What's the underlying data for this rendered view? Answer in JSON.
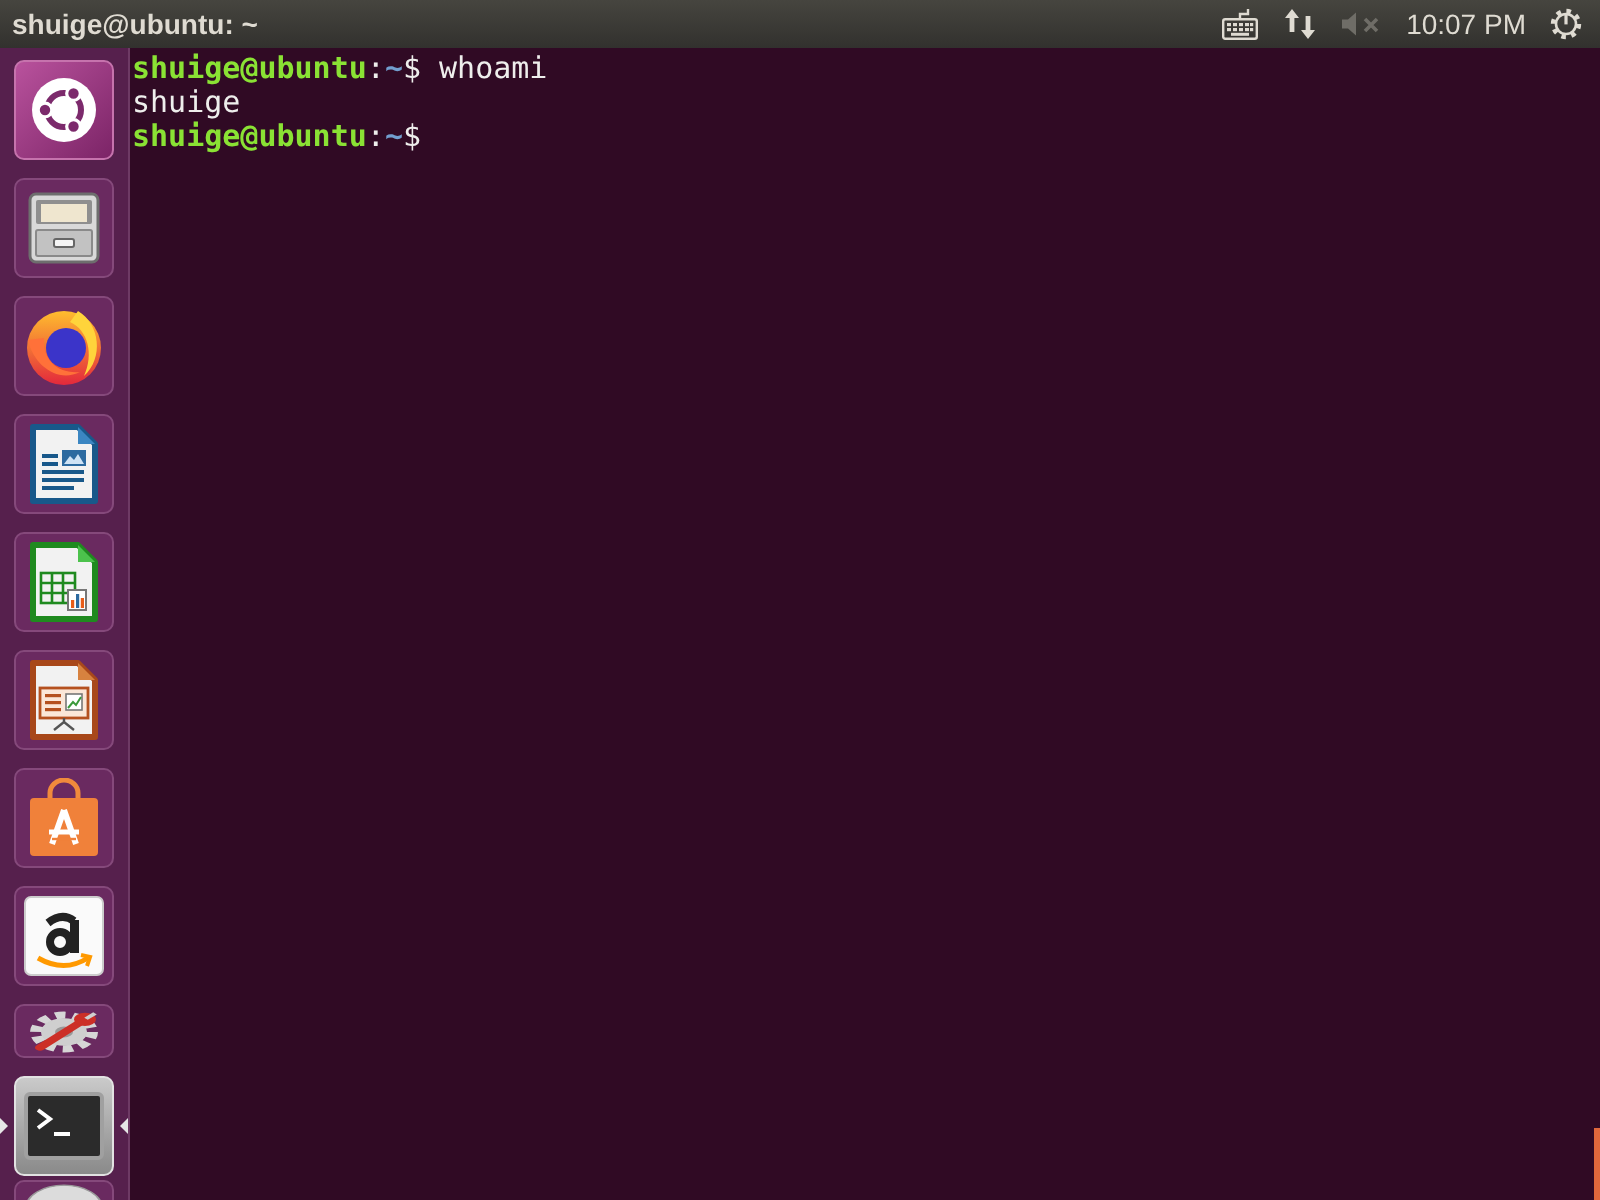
{
  "top_panel": {
    "title": "shuige@ubuntu: ~",
    "indicators": [
      {
        "kind": "keyboard"
      },
      {
        "kind": "network"
      },
      {
        "kind": "sound",
        "muted": true
      },
      {
        "kind": "clock",
        "text": "10:07 PM"
      },
      {
        "kind": "session"
      }
    ]
  },
  "launcher": {
    "items": [
      {
        "kind": "dash",
        "selected": false,
        "running": false,
        "folded": false
      },
      {
        "kind": "files",
        "selected": false,
        "running": false,
        "folded": false
      },
      {
        "kind": "browser",
        "selected": false,
        "running": false,
        "folded": false
      },
      {
        "kind": "writer",
        "selected": false,
        "running": false,
        "folded": false
      },
      {
        "kind": "calc",
        "selected": false,
        "running": false,
        "folded": false
      },
      {
        "kind": "impress",
        "selected": false,
        "running": false,
        "folded": false
      },
      {
        "kind": "software",
        "selected": false,
        "running": false,
        "folded": false
      },
      {
        "kind": "store",
        "selected": false,
        "running": false,
        "folded": false
      },
      {
        "kind": "settings",
        "selected": false,
        "running": false,
        "folded": true
      },
      {
        "kind": "terminal",
        "selected": true,
        "running": true,
        "folded": false
      },
      {
        "kind": "disc",
        "selected": false,
        "running": false,
        "folded": true
      }
    ]
  },
  "terminal": {
    "lines": [
      {
        "kind": "prompt",
        "user_host": "shuige@ubuntu",
        "separator": ":",
        "path": "~",
        "symbol": "$",
        "command": "whoami"
      },
      {
        "kind": "output",
        "text": "shuige"
      },
      {
        "kind": "prompt",
        "user_host": "shuige@ubuntu",
        "separator": ":",
        "path": "~",
        "symbol": "$"
      }
    ]
  }
}
